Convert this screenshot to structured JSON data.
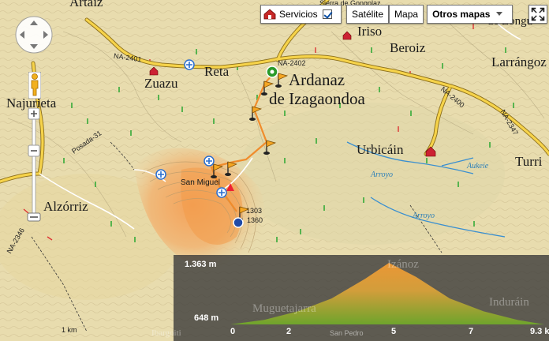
{
  "toolbar": {
    "servicios_label": "Servicios",
    "satelite_label": "Satélite",
    "mapa_label": "Mapa",
    "otros_mapas_label": "Otros mapas"
  },
  "places": {
    "artaiz": "Artaiz",
    "irurozqui": "de Longu",
    "irisó": "Iriso",
    "beroiz": "Beroiz",
    "larrangoz": "Larrángoz",
    "zuazu": "Zuazu",
    "reta": "Reta",
    "ardanaz_line1": "Ardanaz",
    "ardanaz_line2": "de Izagaondoa",
    "najurieta": "Najurieta",
    "urbicain": "Urbicáin",
    "turrillas": "Turri",
    "alzorriz": "Alzórriz",
    "san_miguel": "San Miguel",
    "izanoz": "Izánoz",
    "induráin": "Induráin",
    "muguetajarra": "Muguetajarra",
    "san_pedro": "San Pedro",
    "ibargoiti": "Ibargoiti"
  },
  "roads": {
    "na2401": "NA-2401",
    "na2402": "NA-2402",
    "na2400": "NA-2400",
    "na2346": "NA-2346",
    "na2347": "NA-2347",
    "posada": "Posada-31",
    "sierra_a": "Sierra de Gongolaz"
  },
  "water": {
    "arroyo1": "Arroyo",
    "arroyo2": "Arroyo",
    "aukeia": "Aukeie"
  },
  "peak": {
    "height_a": "1303",
    "height_b": "1360"
  },
  "scale": {
    "label": "1 km"
  },
  "elevation": {
    "max_label": "1.363 m",
    "min_label": "648 m",
    "ticks": [
      "0",
      "2",
      "5",
      "7",
      "9.3 km"
    ]
  },
  "chart_data": {
    "type": "area",
    "x": [
      0,
      1,
      2,
      3,
      4,
      4.7,
      5.5,
      6.5,
      7.5,
      8.5,
      9.3
    ],
    "values": [
      648,
      700,
      800,
      950,
      1180,
      1363,
      1200,
      950,
      800,
      700,
      648
    ],
    "xlabel": "",
    "ylabel": "",
    "ylim": [
      648,
      1363
    ],
    "xlim": [
      0,
      9.3
    ]
  },
  "colors": {
    "map_base": "#e8dcae",
    "road_yellow": "#f6d34a",
    "route_orange": "#f08c2c",
    "elev_peak": "#f29a34",
    "elev_low": "#7aad2a"
  }
}
